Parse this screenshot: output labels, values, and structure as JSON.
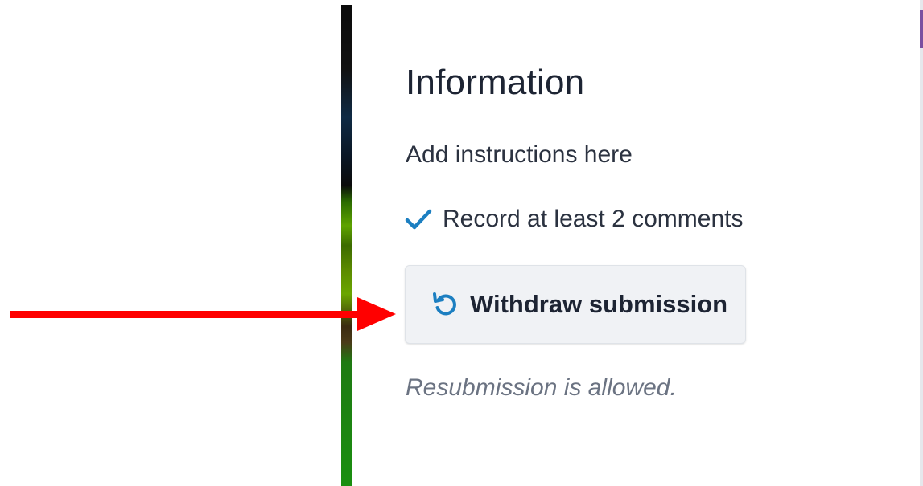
{
  "panel": {
    "title": "Information",
    "instructions": "Add instructions here",
    "requirement": {
      "text": "Record at least 2 comments",
      "icon": "check-icon",
      "completed": true
    },
    "withdraw_button": {
      "label": "Withdraw submission",
      "icon": "undo-icon"
    },
    "resubmission_note": "Resubmission is allowed."
  },
  "colors": {
    "accent_blue": "#1c7fc1",
    "annotation_red": "#ff0000",
    "button_bg": "#f0f2f5",
    "text_primary": "#1d2433",
    "text_muted": "#6b7382",
    "side_accent": "#7b4fa0"
  },
  "annotation": {
    "type": "arrow",
    "icon": "red-arrow-icon",
    "points_to": "withdraw-submission-button"
  }
}
